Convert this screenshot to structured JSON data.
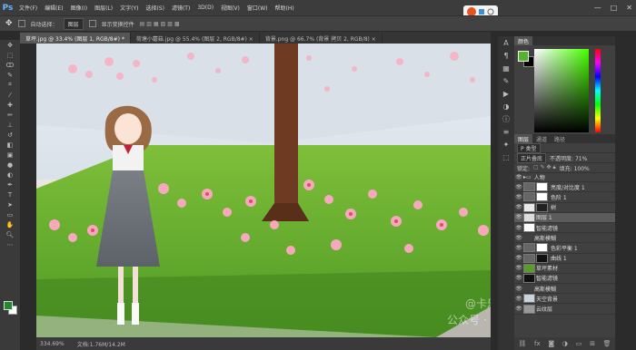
{
  "app": {
    "logo": "Ps"
  },
  "menu": [
    "文件(F)",
    "编辑(E)",
    "图像(I)",
    "图层(L)",
    "文字(Y)",
    "选择(S)",
    "滤镜(T)",
    "3D(D)",
    "视图(V)",
    "窗口(W)",
    "帮助(H)"
  ],
  "window_controls": [
    "—",
    "□",
    "✕"
  ],
  "options_bar": {
    "move_icon": "move-tool-icon",
    "auto_select": "自动选择：",
    "auto_select_target": "图层",
    "show_transform": "显示变换控件"
  },
  "tabs": [
    {
      "label": "草坪.jpg @ 33.4% (图层 1, RGB/8#) *",
      "active": true
    },
    {
      "label": "荷塘小蘑菇.jpg @ 55.4% (图层 2, RGB/8#) ×",
      "active": false
    },
    {
      "label": "背景.png @ 66.7% (背景 拷贝 2, RGB/8) ×",
      "active": false
    }
  ],
  "status": {
    "zoom": "334.69%",
    "doc": "文档:1.76M/14.2M"
  },
  "panels": {
    "color_tabs": [
      "颜色"
    ],
    "layer_tabs": [
      "图层",
      "通道",
      "路径"
    ],
    "filter_label": "P 类型",
    "blend_mode": "正片叠底",
    "opacity_label": "不透明度: 71%",
    "lock_label": "锁定:",
    "fill_label": "填充: 100%"
  },
  "layers": [
    {
      "name": "人物",
      "selected": false
    },
    {
      "name": "亮度/对比度 1",
      "selected": false
    },
    {
      "name": "色阶 1",
      "selected": false
    },
    {
      "name": "树",
      "selected": false
    },
    {
      "name": "图层 1",
      "selected": true
    },
    {
      "name": "智能滤镜",
      "selected": false
    },
    {
      "name": "高斯模糊",
      "selected": false
    },
    {
      "name": "色彩平衡 1",
      "selected": false
    },
    {
      "name": "曲线 1",
      "selected": false
    },
    {
      "name": "草坪素材",
      "selected": false
    },
    {
      "name": "智能滤镜",
      "selected": false
    },
    {
      "name": "高斯模糊",
      "selected": false
    },
    {
      "name": "天空背景",
      "selected": false
    },
    {
      "name": "云纹层",
      "selected": false
    }
  ],
  "watermark": {
    "line1": "@卡乐致",
    "line2": "公众号 · 卡乐琦"
  },
  "colors": {
    "fg": "#4fb52d",
    "bg": "#000000",
    "accent": "#6ab7ff"
  }
}
